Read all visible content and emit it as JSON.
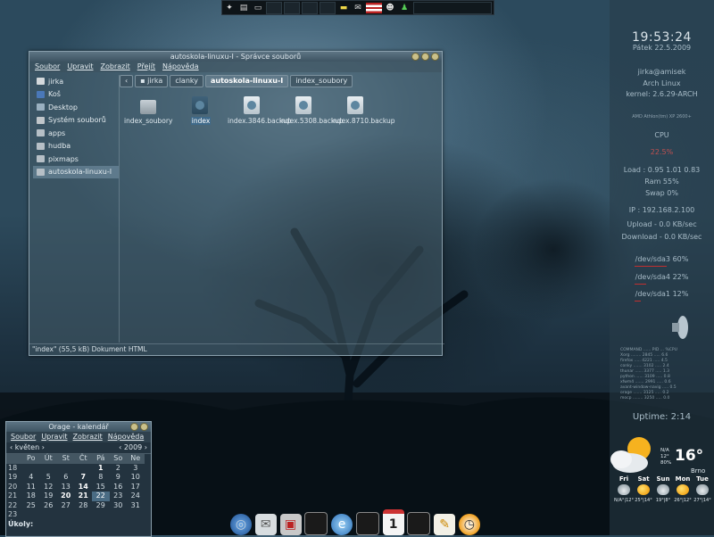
{
  "top_panel": {
    "icons": [
      "launcher-icon",
      "folder-icon",
      "monitor-icon",
      "note-icon",
      "mail-icon",
      "us-flag-icon",
      "tux-icon",
      "runner-icon"
    ]
  },
  "conky": {
    "time": "19:53:24",
    "date": "Pátek 22.5.2009",
    "user": "jirka@amisek",
    "os": "Arch Linux",
    "kernel": "kernel: 2.6.29-ARCH",
    "cpu_model": "AMD Athlon(tm) XP 2600+",
    "cpu_label": "CPU",
    "cpu_usage": "22.5%",
    "load": "Load : 0.95 1.01 0.83",
    "ram": "Ram 55%",
    "swap": "Swap 0%",
    "ip": "IP : 192.168.2.100",
    "upload": "Upload - 0.0 KB/sec",
    "download": "Download - 0.0 KB/sec",
    "disks": [
      "/dev/sda3 60%",
      "/dev/sda4 22%",
      "/dev/sda1 12%"
    ],
    "disk_usage": [
      0.6,
      0.22,
      0.12
    ],
    "processes": [
      "COMMAND ...... PID ... %CPU",
      "Xorg ........ 2845 ..... 6.6",
      "firefox ..... 4221 ..... 4.5",
      "conky ....... 3102 ..... 2.4",
      "thunar ...... 3377 ..... 1.3",
      "python ...... 3109 ..... 0.8",
      "xfwm4 ....... 2991 ..... 0.6",
      "avant-window-navig ..... 0.5",
      "orage ....... 3125 ..... 0.2",
      "mocp ........ 3250 ..... 0.0"
    ],
    "uptime": "Uptime: 2:14"
  },
  "file_manager": {
    "title": "autoskola-linuxu-I - Správce souborů",
    "menu": [
      "Soubor",
      "Upravit",
      "Zobrazit",
      "Přejít",
      "Nápověda"
    ],
    "sidebar": [
      {
        "label": "jirka",
        "icon": "home-icon",
        "color": "#d4d9dc"
      },
      {
        "label": "Koš",
        "icon": "trash-icon",
        "color": "#4a78b8"
      },
      {
        "label": "Desktop",
        "icon": "desktop-icon",
        "color": "#9ab0c0"
      },
      {
        "label": "Systém souborů",
        "icon": "drive-icon",
        "color": "#c0c6ca"
      },
      {
        "label": "apps",
        "icon": "folder-icon",
        "color": "#b6bfc6"
      },
      {
        "label": "hudba",
        "icon": "folder-icon",
        "color": "#b6bfc6"
      },
      {
        "label": "pixmaps",
        "icon": "folder-icon",
        "color": "#b6bfc6"
      },
      {
        "label": "autoskola-linuxu-I",
        "icon": "folder-icon",
        "color": "#b6bfc6"
      }
    ],
    "path": [
      "jirka",
      "clanky",
      "autoskola-linuxu-I",
      "index_soubory"
    ],
    "files": [
      {
        "name": "index_soubory",
        "type": "folder"
      },
      {
        "name": "index",
        "type": "html"
      },
      {
        "name": "index.3846.backup",
        "type": "html"
      },
      {
        "name": "index.5308.backup",
        "type": "html"
      },
      {
        "name": "index.8710.backup",
        "type": "html"
      }
    ],
    "status": "\"index\" (55,5 kB) Dokument HTML"
  },
  "calendar": {
    "title": "Orage - kalendář",
    "menu": [
      "Soubor",
      "Upravit",
      "Zobrazit",
      "Nápověda"
    ],
    "month": "květen",
    "year": "2009",
    "weekdays": [
      "Po",
      "Út",
      "St",
      "Čt",
      "Pá",
      "So",
      "Ne"
    ],
    "weeks": [
      {
        "wk": "18",
        "days": [
          "",
          "",
          "",
          "",
          "1",
          "2",
          "3"
        ]
      },
      {
        "wk": "19",
        "days": [
          "4",
          "5",
          "6",
          "7",
          "8",
          "9",
          "10"
        ]
      },
      {
        "wk": "20",
        "days": [
          "11",
          "12",
          "13",
          "14",
          "15",
          "16",
          "17"
        ]
      },
      {
        "wk": "21",
        "days": [
          "18",
          "19",
          "20",
          "21",
          "22",
          "23",
          "24"
        ]
      },
      {
        "wk": "22",
        "days": [
          "25",
          "26",
          "27",
          "28",
          "29",
          "30",
          "31"
        ]
      },
      {
        "wk": "23",
        "days": [
          "",
          "",
          "",
          "",
          "",
          "",
          ""
        ]
      }
    ],
    "today": "22",
    "tasks_label": "Úkoly:"
  },
  "dock": {
    "items": [
      "globe-icon",
      "mail-client-icon",
      "package-icon",
      "terminal-icon",
      "browser-icon",
      "terminal-icon",
      "calendar-icon",
      "screen-icon",
      "editor-icon",
      "clock-icon"
    ],
    "calendar_day": "1"
  },
  "weather": {
    "temp": "16°",
    "condition": "N/A",
    "feels": "12°",
    "humidity": "80%",
    "city": "Brno",
    "forecast": [
      {
        "day": "Fri",
        "range": "N/A°|12°",
        "icon": "cloud"
      },
      {
        "day": "Sat",
        "range": "25°|14°",
        "icon": "sun"
      },
      {
        "day": "Sun",
        "range": "19°|8°",
        "icon": "cloud"
      },
      {
        "day": "Mon",
        "range": "26°|12°",
        "icon": "sun"
      },
      {
        "day": "Tue",
        "range": "27°|14°",
        "icon": "cloud"
      }
    ]
  }
}
